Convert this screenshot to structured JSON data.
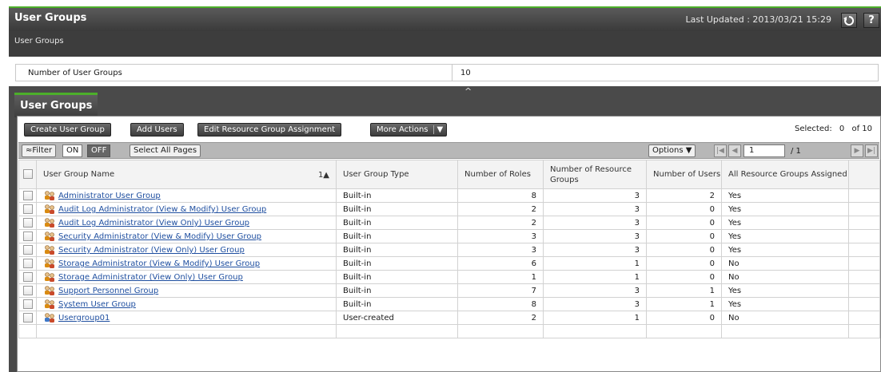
{
  "window": {
    "title": "User Groups",
    "last_updated": "Last Updated : 2013/03/21 15:29",
    "refresh_icon": "refresh-icon",
    "help_label": "?"
  },
  "breadcrumb": "User Groups",
  "summary": {
    "label": "Number of User Groups",
    "value": "10"
  },
  "collapse_glyph": "^",
  "tab": {
    "label": "User Groups"
  },
  "actions": {
    "create": "Create User Group",
    "add_users": "Add Users",
    "edit_rg": "Edit Resource Group Assignment",
    "more": "More Actions",
    "more_arrow": "▼",
    "selected_label": "Selected:",
    "selected_count": "0",
    "selected_of": "of 10"
  },
  "filter": {
    "filter_label": "≈Filter",
    "on": "ON",
    "off": "OFF",
    "select_all": "Select All Pages",
    "options": "Options ▼",
    "page_value": "1",
    "page_total": "/ 1"
  },
  "columns": {
    "name": "User Group Name",
    "sort": "1▲",
    "type": "User Group Type",
    "roles": "Number of Roles",
    "rgs": "Number of Resource Groups",
    "users": "Number of Users",
    "all_rg": "All Resource Groups Assigned"
  },
  "rows": [
    {
      "name": "Administrator User Group",
      "type": "Built-in",
      "roles": "8",
      "rgs": "3",
      "users": "2",
      "all_rg": "Yes",
      "icon": "builtin-group-icon"
    },
    {
      "name": "Audit Log Administrator (View & Modify) User Group",
      "type": "Built-in",
      "roles": "2",
      "rgs": "3",
      "users": "0",
      "all_rg": "Yes",
      "icon": "builtin-group-icon"
    },
    {
      "name": "Audit Log Administrator (View Only) User Group",
      "type": "Built-in",
      "roles": "2",
      "rgs": "3",
      "users": "0",
      "all_rg": "Yes",
      "icon": "builtin-group-icon"
    },
    {
      "name": "Security Administrator (View & Modify) User Group",
      "type": "Built-in",
      "roles": "3",
      "rgs": "3",
      "users": "0",
      "all_rg": "Yes",
      "icon": "builtin-group-icon"
    },
    {
      "name": "Security Administrator (View Only) User Group",
      "type": "Built-in",
      "roles": "3",
      "rgs": "3",
      "users": "0",
      "all_rg": "Yes",
      "icon": "builtin-group-icon"
    },
    {
      "name": "Storage Administrator (View & Modify) User Group",
      "type": "Built-in",
      "roles": "6",
      "rgs": "1",
      "users": "0",
      "all_rg": "No",
      "icon": "builtin-group-icon"
    },
    {
      "name": "Storage Administrator (View Only) User Group",
      "type": "Built-in",
      "roles": "1",
      "rgs": "1",
      "users": "0",
      "all_rg": "No",
      "icon": "builtin-group-icon"
    },
    {
      "name": "Support Personnel Group",
      "type": "Built-in",
      "roles": "7",
      "rgs": "3",
      "users": "1",
      "all_rg": "Yes",
      "icon": "builtin-group-icon"
    },
    {
      "name": "System User Group",
      "type": "Built-in",
      "roles": "8",
      "rgs": "3",
      "users": "1",
      "all_rg": "Yes",
      "icon": "builtin-group-icon"
    },
    {
      "name": "Usergroup01",
      "type": "User-created",
      "roles": "2",
      "rgs": "1",
      "users": "0",
      "all_rg": "No",
      "icon": "user-group-icon"
    }
  ],
  "colors": {
    "accent_green": "#4caf2a",
    "link_blue": "#1f4fa0",
    "header_dark": "#3d3d3d"
  }
}
